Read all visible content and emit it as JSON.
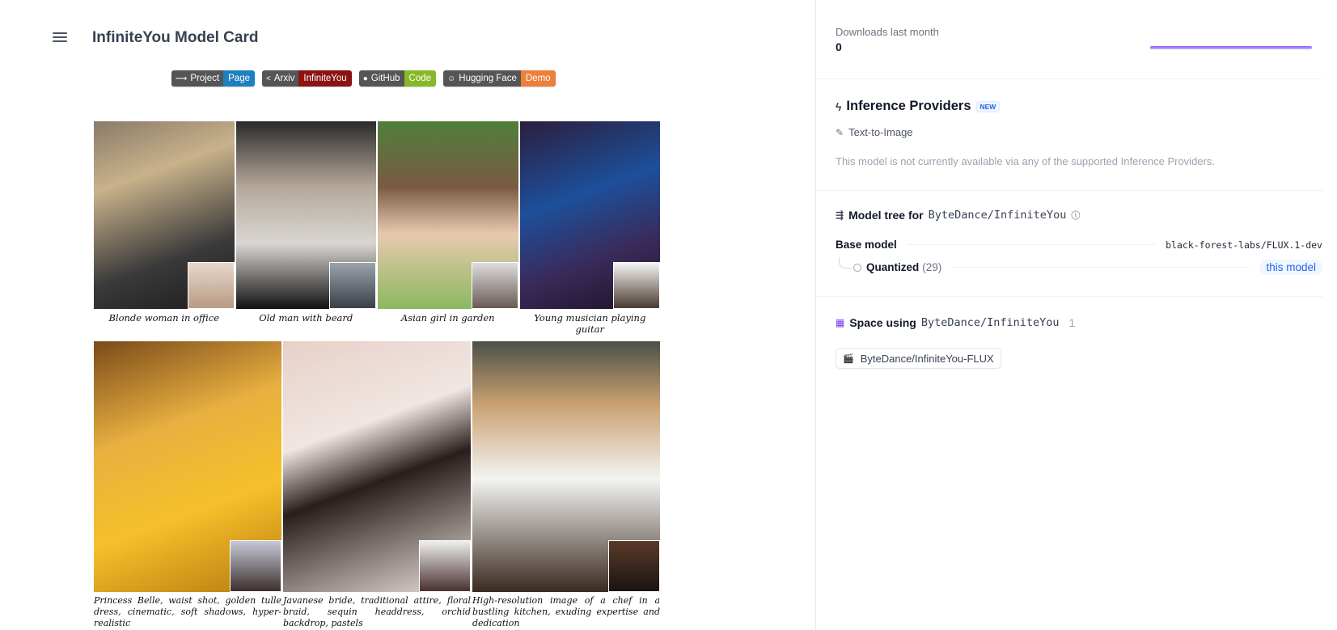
{
  "header": {
    "title": "InfiniteYou Model Card",
    "menu_icon": "hamburger-menu-icon"
  },
  "badges": [
    {
      "left": "Project",
      "right": "Page",
      "right_color": "#1f7fbf",
      "icon": "link-icon"
    },
    {
      "left": "Arxiv",
      "right": "InfiniteYou",
      "right_color": "#8b1313",
      "icon": "arxiv-icon"
    },
    {
      "left": "GitHub",
      "right": "Code",
      "right_color": "#87b827",
      "icon": "github-icon"
    },
    {
      "left": "Hugging Face",
      "right": "Demo",
      "right_color": "#ec7f3b",
      "icon": "hugging-face-icon"
    }
  ],
  "gallery": {
    "row1": [
      {
        "caption": "Blonde woman in office"
      },
      {
        "caption": "Old man with beard"
      },
      {
        "caption": "Asian girl in garden"
      },
      {
        "caption": "Young musician playing guitar"
      }
    ],
    "row2": [
      {
        "caption": "Princess Belle, waist shot, golden tulle dress, cinematic, soft shadows, hyper-realistic"
      },
      {
        "caption": "Javanese bride, traditional attire, floral braid, sequin headdress, orchid backdrop, pastels"
      },
      {
        "caption": "High-resolution image of a chef in a bustling kitchen, exuding expertise and dedication"
      }
    ]
  },
  "sidebar": {
    "downloads": {
      "label": "Downloads last month",
      "value": "0"
    },
    "inference": {
      "title": "Inference Providers",
      "badge": "NEW",
      "task": "Text-to-Image",
      "note": "This model is not currently available via any of the supported Inference Providers."
    },
    "model_tree": {
      "title_prefix": "Model tree for",
      "repo": "ByteDance/InfiniteYou",
      "base_label": "Base model",
      "base_value": "black-forest-labs/FLUX.1-dev",
      "quantized_label": "Quantized",
      "quantized_count": "(29)",
      "this_model": "this model"
    },
    "spaces": {
      "title_prefix": "Space using",
      "repo": "ByteDance/InfiniteYou",
      "count": "1",
      "items": [
        "ByteDance/InfiniteYou-FLUX"
      ]
    }
  }
}
